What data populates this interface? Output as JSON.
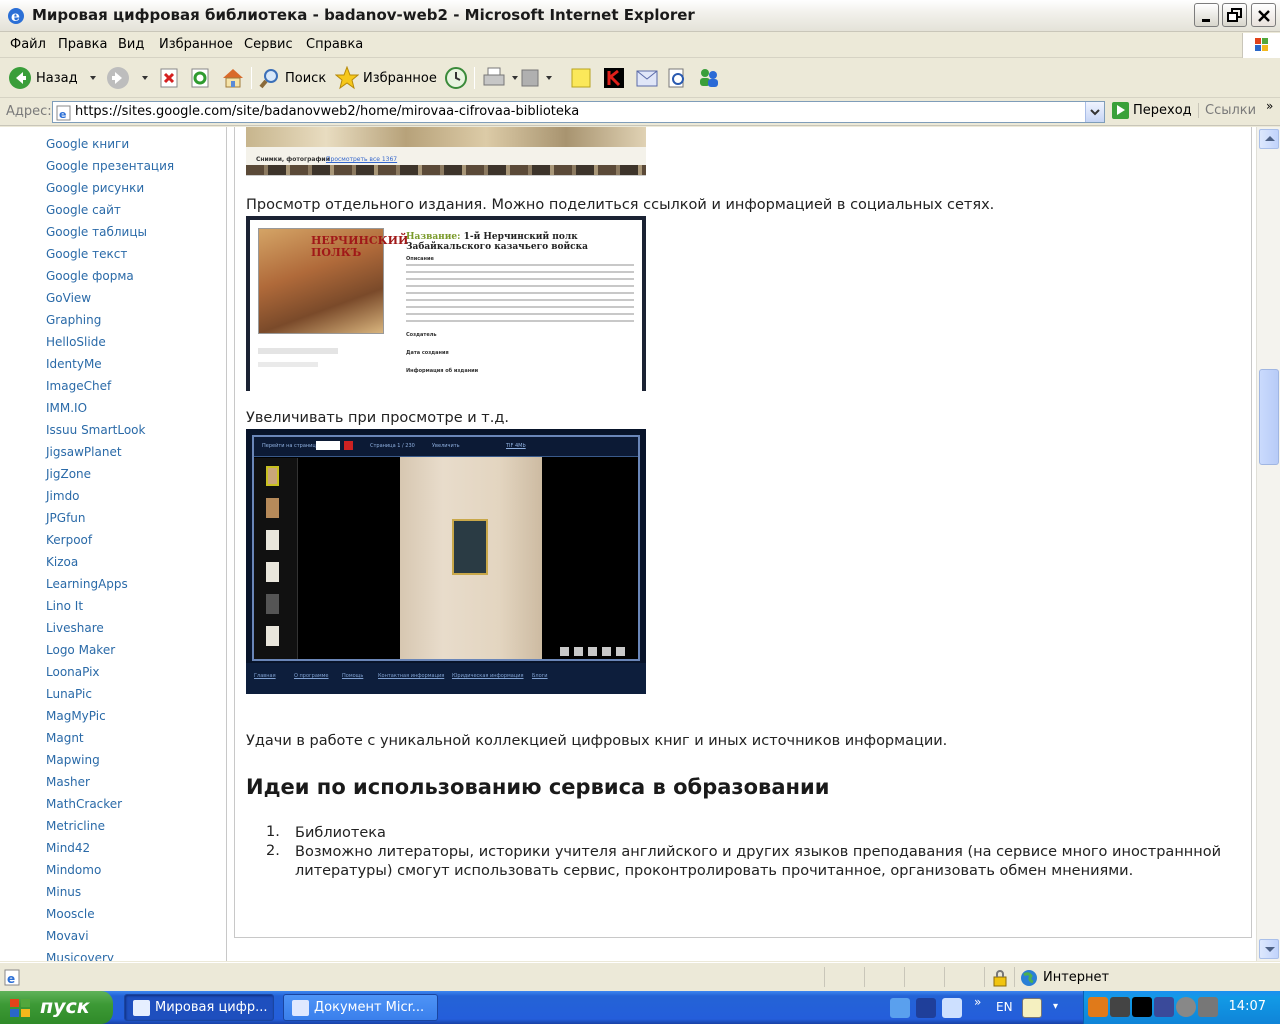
{
  "window": {
    "title": "Мировая цифровая библиотека - badanov-web2 - Microsoft Internet Explorer"
  },
  "menu": [
    "Файл",
    "Правка",
    "Вид",
    "Избранное",
    "Сервис",
    "Справка"
  ],
  "toolbar": {
    "back_label": "Назад",
    "search_label": "Поиск",
    "favorites_label": "Избранное"
  },
  "address": {
    "label": "Адрес:",
    "url": "https://sites.google.com/site/badanovweb2/home/mirovaa-cifrovaa-biblioteka",
    "go_label": "Переход",
    "links_label": "Ссылки"
  },
  "sidebar": {
    "items": [
      "Google книги",
      "Google презентация",
      "Google рисунки",
      "Google сайт",
      "Google таблицы",
      "Google текст",
      "Google форма",
      "GoView",
      "Graphing",
      "HelloSlide",
      "IdentyMe",
      "ImageChef",
      "IMM.IO",
      "Issuu SmartLook",
      "JigsawPlanet",
      "JigZone",
      "Jimdo",
      "JPGfun",
      "Kerpoof",
      "Kizoa",
      "LearningApps",
      "Lino It",
      "Liveshare",
      "Logo Maker",
      "LoonaPix",
      "LunaPic",
      "MagMyPic",
      "Magnt",
      "Mapwing",
      "Masher",
      "MathCracker",
      "Metricline",
      "Mind42",
      "Mindomo",
      "Minus",
      "Mooscle",
      "Movavi",
      "Musicovery"
    ]
  },
  "main": {
    "img_top": {
      "caption": "Снимки, фотографии",
      "link": "Просмотреть все 1367"
    },
    "para1": "Просмотр отдельного издания. Можно поделиться ссылкой и информацией в социальных сетях.",
    "img_pub": {
      "poster_text": "НЕРЧИНСКИЙ ПОЛКЪ",
      "title_label": "Название:",
      "title": "1-й Нерчинский полк Забайкальского казачьего войска",
      "desc_label": "Описание",
      "creator_label": "Создатель",
      "date_label": "Дата создания",
      "info_label": "Информация об издании"
    },
    "para2": "Увеличивать при просмотре и т.д.",
    "img_view": {
      "goto": "Перейти на страницу",
      "page": "Страница 1 / 230",
      "zoom": "Увеличить",
      "tiff": "TIF 4Mb",
      "footer": [
        "Главная",
        "О программе",
        "Помощь",
        "Контактная информация",
        "Юридическая информация",
        "Блоги"
      ]
    },
    "para3": "Удачи в работе с уникальной коллекцией цифровых книг и иных источников информации.",
    "heading": "Идеи по использованию сервиса в образовании",
    "list": [
      {
        "num": "1.",
        "text": "Библиотека"
      },
      {
        "num": "2.",
        "text": "Возможно литераторы, историки учителя английского и других языков преподавания (на сервисе много иностраннной литературы) смогут использовать сервис, проконтролировать прочитанное, организовать обмен мнениями."
      }
    ]
  },
  "status": {
    "zone": "Интернет"
  },
  "taskbar": {
    "start": "пуск",
    "tasks": [
      "Мировая цифр...",
      "Документ Micr..."
    ],
    "lang": "EN",
    "clock": "14:07"
  }
}
